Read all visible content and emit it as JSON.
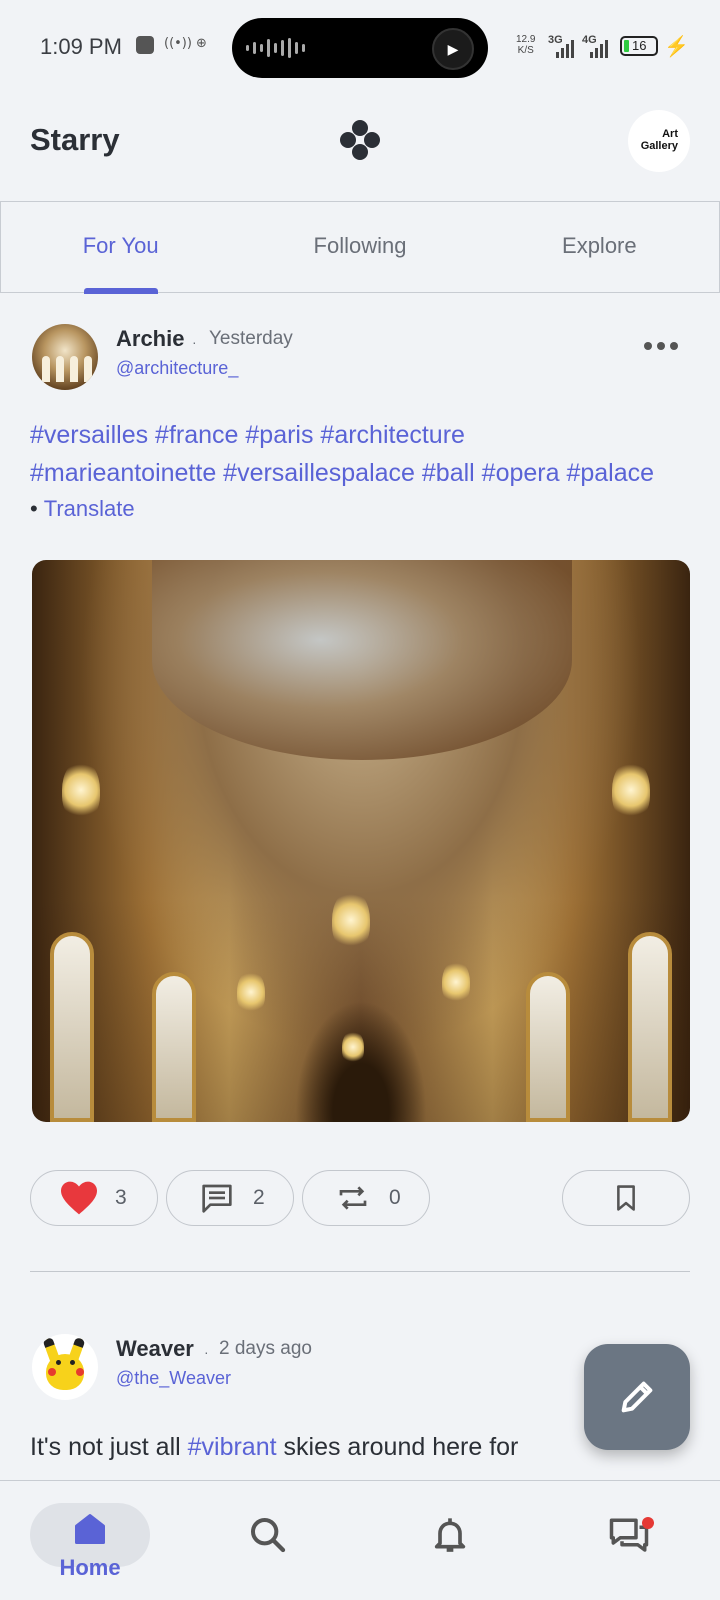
{
  "status_bar": {
    "time": "1:09 PM",
    "net_speed_value": "12.9",
    "net_speed_unit": "K/S",
    "signal_1": "3G",
    "signal_2": "4G",
    "battery": "16"
  },
  "header": {
    "title": "Starry",
    "profile_badge_line1": "Art",
    "profile_badge_line2": "Gallery"
  },
  "tabs": [
    {
      "label": "For You",
      "active": true
    },
    {
      "label": "Following",
      "active": false
    },
    {
      "label": "Explore",
      "active": false
    }
  ],
  "post1": {
    "author": "Archie",
    "time": "Yesterday",
    "handle": "@architecture_",
    "text_line1": "#versailles #france #paris #architecture",
    "text_line2": "#marieantoinette #versaillespalace #ball #opera #palace",
    "bullet": "•",
    "translate": "Translate",
    "likes": "3",
    "comments": "2",
    "reposts": "0"
  },
  "post2": {
    "author": "Weaver",
    "time": "2 days ago",
    "handle": "@the_Weaver",
    "text_before": "It's not just all ",
    "tag": "#vibrant",
    "text_after": " skies around here for"
  },
  "bottom_nav": {
    "home": "Home"
  },
  "colors": {
    "accent": "#5a63d6",
    "like_red": "#e8383d",
    "fab": "#6b7683"
  }
}
